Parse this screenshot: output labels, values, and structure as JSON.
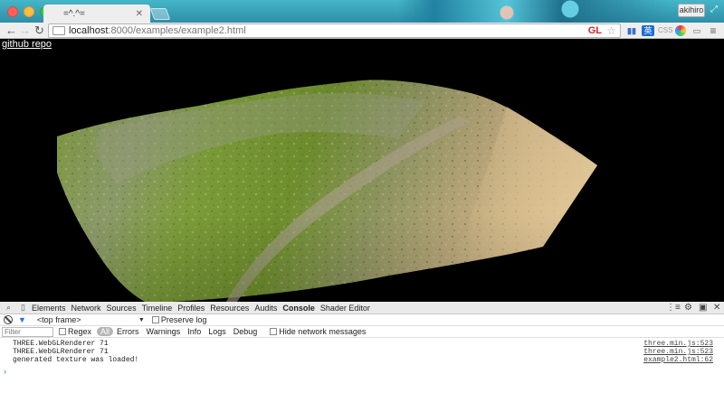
{
  "window": {
    "tab_title": "=^.^=",
    "tab_close": "✕",
    "profile_name": "akihiro"
  },
  "toolbar": {
    "url_host": "localhost",
    "url_path": ":8000/examples/example2.html",
    "gl_badge": "GL",
    "ext_css": "CSS"
  },
  "page": {
    "github_link": "github repo"
  },
  "devtools": {
    "tabs": [
      "Elements",
      "Network",
      "Sources",
      "Timeline",
      "Profiles",
      "Resources",
      "Audits",
      "Console",
      "Shader Editor"
    ],
    "frame_select": "<top frame>",
    "preserve_log": "Preserve log",
    "filter_placeholder": "Filter",
    "regex_label": "Regex",
    "levels": [
      "All",
      "Errors",
      "Warnings",
      "Info",
      "Logs",
      "Debug"
    ],
    "hide_network": "Hide network messages",
    "logs": [
      {
        "message": "THREE.WebGLRenderer 71",
        "source": "three.min.js:523"
      },
      {
        "message": "THREE.WebGLRenderer 71",
        "source": "three.min.js:523"
      },
      {
        "message": "generated texture was loaded!",
        "source": "example2.html:62"
      }
    ],
    "prompt": "›"
  }
}
